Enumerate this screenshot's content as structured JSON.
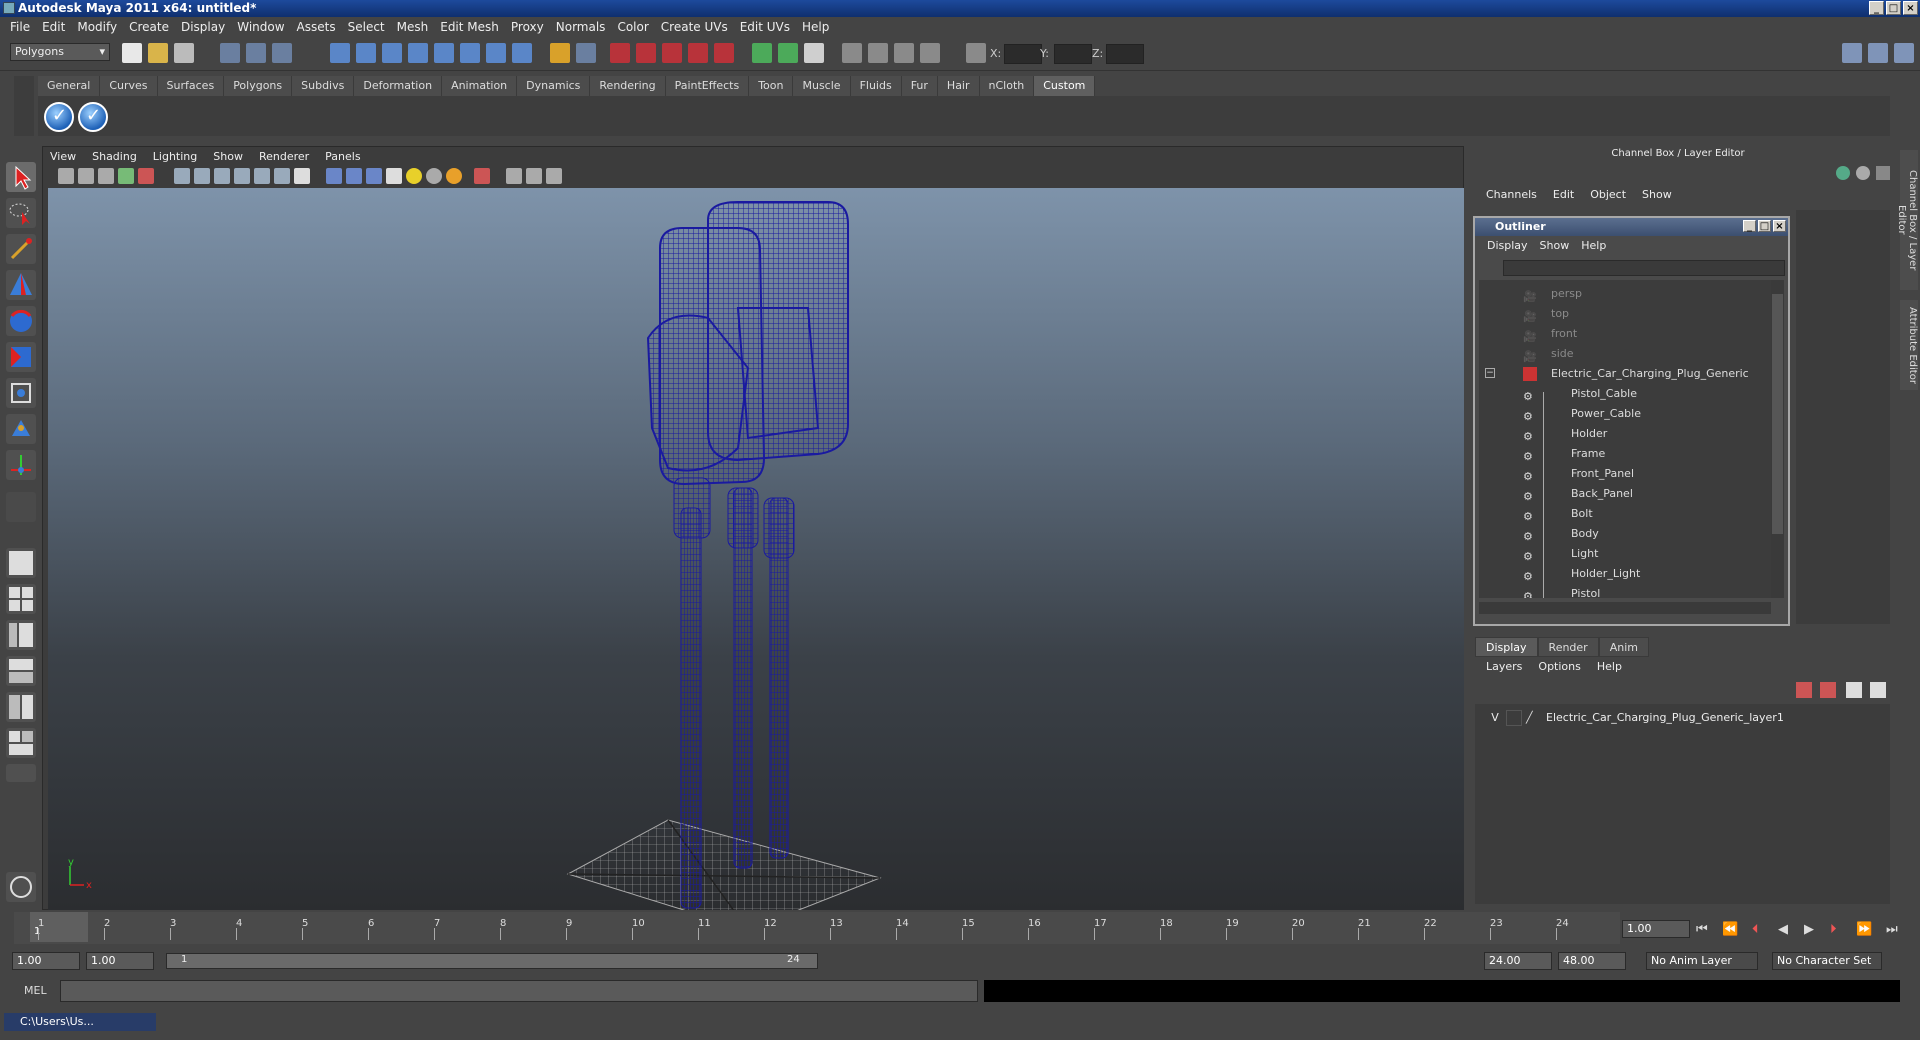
{
  "window": {
    "title": "Autodesk Maya 2011 x64: untitled*"
  },
  "menubar": [
    "File",
    "Edit",
    "Modify",
    "Create",
    "Display",
    "Window",
    "Assets",
    "Select",
    "Mesh",
    "Edit Mesh",
    "Proxy",
    "Normals",
    "Color",
    "Create UVs",
    "Edit UVs",
    "Help"
  ],
  "status": {
    "mode": "Polygons",
    "x_label": "X:",
    "y_label": "Y:",
    "z_label": "Z:"
  },
  "shelf_tabs": [
    "General",
    "Curves",
    "Surfaces",
    "Polygons",
    "Subdivs",
    "Deformation",
    "Animation",
    "Dynamics",
    "Rendering",
    "PaintEffects",
    "Toon",
    "Muscle",
    "Fluids",
    "Fur",
    "Hair",
    "nCloth",
    "Custom"
  ],
  "active_shelf": "Custom",
  "panel_menu": [
    "View",
    "Shading",
    "Lighting",
    "Show",
    "Renderer",
    "Panels"
  ],
  "channel_box": {
    "title": "Channel Box / Layer Editor",
    "menu": [
      "Channels",
      "Edit",
      "Object",
      "Show"
    ]
  },
  "outliner": {
    "title": "Outliner",
    "menu": [
      "Display",
      "Show",
      "Help"
    ],
    "cameras": [
      "persp",
      "top",
      "front",
      "side"
    ],
    "group": "Electric_Car_Charging_Plug_Generic",
    "children": [
      "Pistol_Cable",
      "Power_Cable",
      "Holder",
      "Frame",
      "Front_Panel",
      "Back_Panel",
      "Bolt",
      "Body",
      "Light",
      "Holder_Light",
      "Pistol"
    ]
  },
  "layer_editor": {
    "tabs": [
      "Display",
      "Render",
      "Anim"
    ],
    "active_tab": "Display",
    "menu": [
      "Layers",
      "Options",
      "Help"
    ],
    "layer": {
      "visible": "V",
      "name": "Electric_Car_Charging_Plug_Generic_layer1"
    }
  },
  "side_tabs": [
    "Channel Box / Layer Editor",
    "Attribute Editor"
  ],
  "timeline": {
    "ticks": [
      "1",
      "2",
      "3",
      "4",
      "5",
      "6",
      "7",
      "8",
      "9",
      "10",
      "11",
      "12",
      "13",
      "14",
      "15",
      "16",
      "17",
      "18",
      "19",
      "20",
      "21",
      "22",
      "23",
      "24"
    ],
    "current": "1.00",
    "frame_marker": "1"
  },
  "range": {
    "start": "1.00",
    "anim_start": "1.00",
    "slider_start": "1",
    "slider_end": "24",
    "end": "24.00",
    "anim_end": "48.00",
    "anim_layer": "No Anim Layer",
    "char_set": "No Character Set"
  },
  "command": {
    "label": "MEL"
  },
  "taskbar": {
    "item": "C:\\Users\\Us..."
  },
  "colors": {
    "wire": "#1a1aa0",
    "bg_top": "#7e93aa",
    "bg_bottom": "#2b2d30",
    "accent": "#3c4f70"
  }
}
